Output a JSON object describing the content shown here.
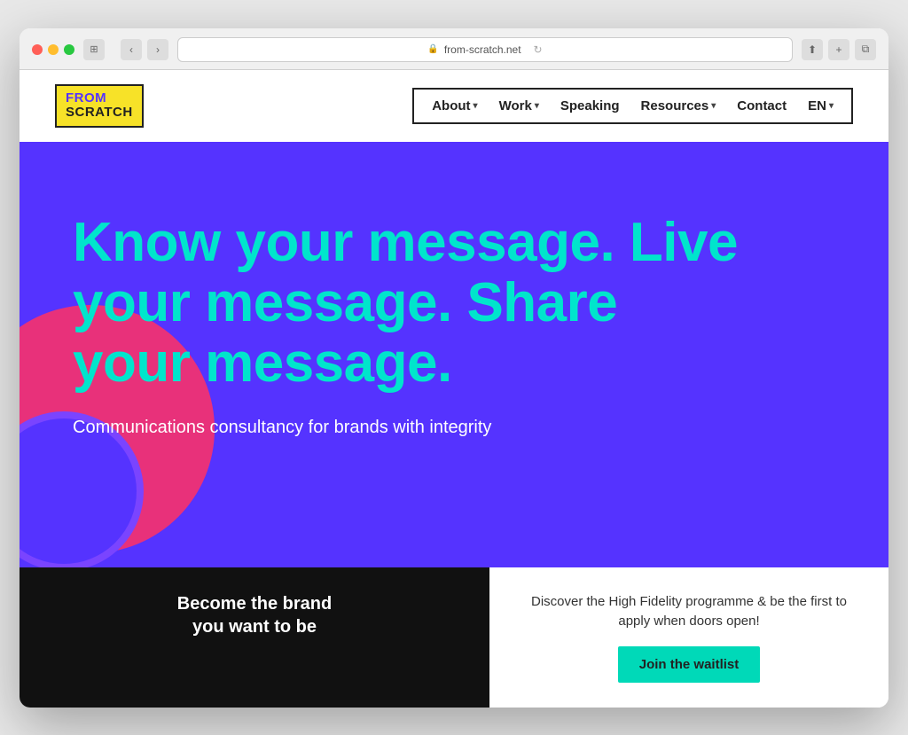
{
  "browser": {
    "url": "from-scratch.net",
    "url_display": "from-scratch.net"
  },
  "logo": {
    "line1": "FROM",
    "line2": "SCRATCH"
  },
  "nav": {
    "items": [
      {
        "label": "About",
        "hasDropdown": true
      },
      {
        "label": "Work",
        "hasDropdown": true
      },
      {
        "label": "Speaking",
        "hasDropdown": false
      },
      {
        "label": "Resources",
        "hasDropdown": true
      },
      {
        "label": "Contact",
        "hasDropdown": false
      },
      {
        "label": "EN",
        "hasDropdown": true
      }
    ]
  },
  "hero": {
    "headline": "Know your message. Live your message. Share your message.",
    "subheadline": "Communications consultancy for brands with integrity"
  },
  "cta": {
    "black_text": "Become the brand\nyou want to be",
    "white_text": "Discover the High Fidelity programme & be the first to apply when doors open!",
    "button_label": "Join the waitlist"
  }
}
